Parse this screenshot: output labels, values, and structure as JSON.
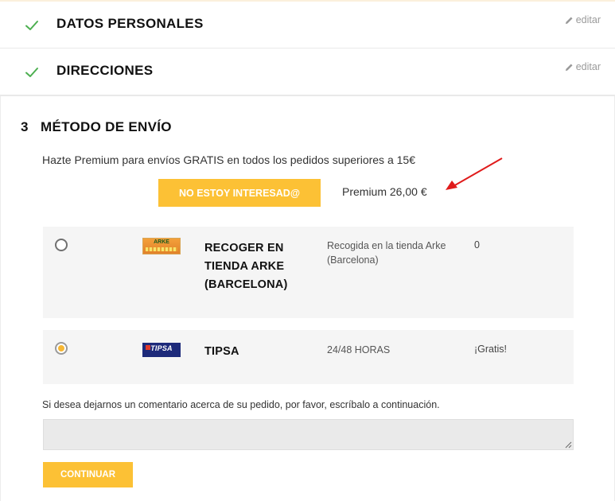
{
  "steps": {
    "personal": {
      "title": "DATOS PERSONALES",
      "edit_label": "editar"
    },
    "addresses": {
      "title": "DIRECCIONES",
      "edit_label": "editar"
    }
  },
  "shipping": {
    "step_number": "3",
    "title": "MÉTODO DE ENVÍO",
    "premium_text": "Hazte Premium para envíos GRATIS en todos los pedidos superiores a 15€",
    "decline_label": "NO ESTOY INTERESAD@",
    "premium_price": "Premium 26,00 €",
    "carriers": [
      {
        "logo_text": "ARKE",
        "name": "RECOGER EN TIENDA ARKE (BARCELONA)",
        "delay": "Recogida en la tienda Arke (Barcelona)",
        "price": "0",
        "selected": false
      },
      {
        "logo_text": "TIPSA",
        "name": "TIPSA",
        "delay": "24/48 HORAS",
        "price": "¡Gratis!",
        "selected": true
      }
    ],
    "comment_label": "Si desea dejarnos un comentario acerca de su pedido, por favor, escríbalo a continuación.",
    "comment_value": "",
    "continue_label": "CONTINUAR"
  },
  "colors": {
    "accent": "#fcc135",
    "check": "#4caf50",
    "arrow": "#e01b1b",
    "radio_selected": "#f7b733"
  },
  "icons": {
    "check": "check-icon",
    "edit": "pencil-icon",
    "arrow": "arrow-annotation-icon"
  }
}
